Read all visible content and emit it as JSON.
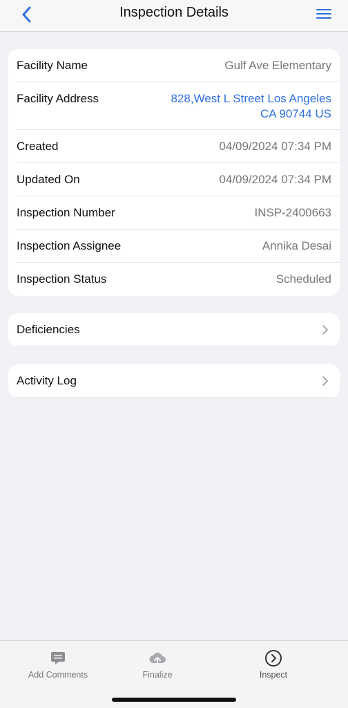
{
  "header": {
    "title": "Inspection Details",
    "back_icon": "chevron-left-icon",
    "menu_icon": "hamburger-menu-icon",
    "accent": "#2f6fde"
  },
  "details": [
    {
      "label": "Facility Name",
      "value": "Gulf Ave Elementary"
    },
    {
      "label": "Facility Address",
      "value_line1": "828,West L Street Los Angeles",
      "value_line2": "CA 90744 US"
    },
    {
      "label": "Created",
      "value": "04/09/2024 07:34 PM"
    },
    {
      "label": "Updated On",
      "value": "04/09/2024 07:34 PM"
    },
    {
      "label": "Inspection Number",
      "value": "INSP-2400663"
    },
    {
      "label": "Inspection Assignee",
      "value": "Annika Desai"
    },
    {
      "label": "Inspection Status",
      "value": "Scheduled"
    }
  ],
  "sections": [
    {
      "label": "Deficiencies"
    },
    {
      "label": "Activity Log"
    }
  ],
  "tab_bar": {
    "add_comments": {
      "label": "Add Comments",
      "icon": "comment-icon"
    },
    "finalize": {
      "label": "Finalize",
      "icon": "cloud-upload-icon"
    },
    "inspect": {
      "label": "Inspect",
      "icon": "circle-chevron-right-icon"
    }
  }
}
